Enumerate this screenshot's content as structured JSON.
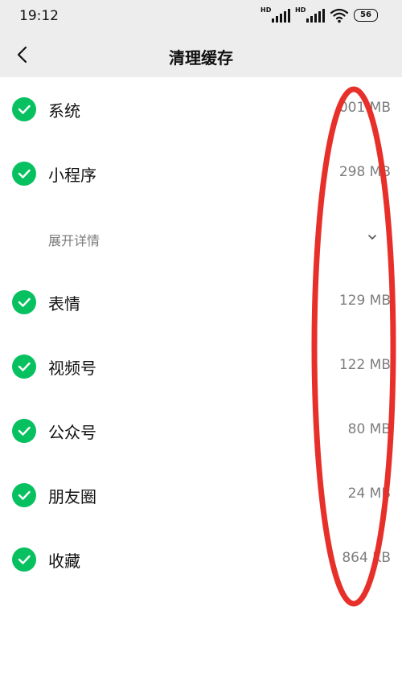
{
  "status": {
    "time": "19:12",
    "hd1": "HD",
    "hd2": "HD",
    "battery": "56"
  },
  "header": {
    "title": "清理缓存"
  },
  "items": [
    {
      "name": "系统",
      "size": "001 MB"
    },
    {
      "name": "小程序",
      "size": "298 MB"
    },
    {
      "name": "表情",
      "size": "129 MB"
    },
    {
      "name": "视频号",
      "size": "122 MB"
    },
    {
      "name": "公众号",
      "size": "80 MB"
    },
    {
      "name": "朋友圈",
      "size": "24 MB"
    },
    {
      "name": "收藏",
      "size": "864 KB"
    }
  ],
  "expand": {
    "label": "展开详情"
  },
  "colors": {
    "accent": "#07c160",
    "annotation": "#e8302b",
    "header_bg": "#ededed"
  }
}
